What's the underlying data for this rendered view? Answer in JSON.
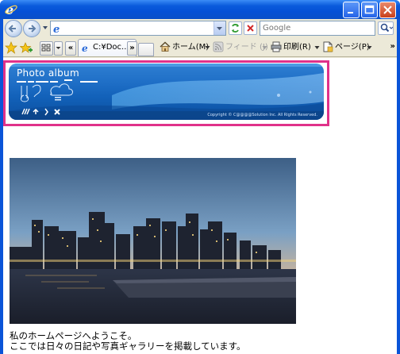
{
  "window": {
    "controls": {
      "minimize": "minimize",
      "maximize": "maximize",
      "close": "close"
    }
  },
  "address_bar": {
    "url": "",
    "search_placeholder": "Google"
  },
  "command_bar": {
    "tab_title": "C:¥Doc...",
    "tab_close": "×",
    "tab_nav_left": "«",
    "tab_nav_right": "»",
    "home_label": "ホーム(M)",
    "feed_label": "フィード (J)",
    "print_label": "印刷(R)",
    "page_label": "ページ(P)",
    "overflow": "»"
  },
  "banner": {
    "title": "Photo album",
    "copyright": "Copyright © C@@@@Solution Inc. All Rights Reserved."
  },
  "caption": {
    "line1": "私のホームページへようこそ。",
    "line2": "ここでは日々の日記や写真ギャラリーを掲載しています。"
  },
  "colors": {
    "title_bar": "#0a5bdc",
    "highlight_border": "#e0318a",
    "banner_blue": "#1e6ec6"
  }
}
